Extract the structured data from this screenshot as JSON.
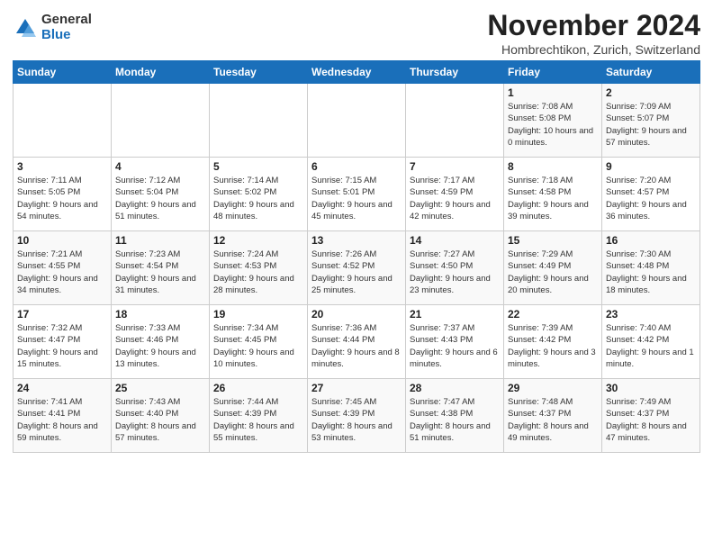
{
  "logo": {
    "general": "General",
    "blue": "Blue"
  },
  "title": "November 2024",
  "location": "Hombrechtikon, Zurich, Switzerland",
  "weekdays": [
    "Sunday",
    "Monday",
    "Tuesday",
    "Wednesday",
    "Thursday",
    "Friday",
    "Saturday"
  ],
  "weeks": [
    [
      {
        "day": "",
        "sunrise": "",
        "sunset": "",
        "daylight": ""
      },
      {
        "day": "",
        "sunrise": "",
        "sunset": "",
        "daylight": ""
      },
      {
        "day": "",
        "sunrise": "",
        "sunset": "",
        "daylight": ""
      },
      {
        "day": "",
        "sunrise": "",
        "sunset": "",
        "daylight": ""
      },
      {
        "day": "",
        "sunrise": "",
        "sunset": "",
        "daylight": ""
      },
      {
        "day": "1",
        "sunrise": "Sunrise: 7:08 AM",
        "sunset": "Sunset: 5:08 PM",
        "daylight": "Daylight: 10 hours and 0 minutes."
      },
      {
        "day": "2",
        "sunrise": "Sunrise: 7:09 AM",
        "sunset": "Sunset: 5:07 PM",
        "daylight": "Daylight: 9 hours and 57 minutes."
      }
    ],
    [
      {
        "day": "3",
        "sunrise": "Sunrise: 7:11 AM",
        "sunset": "Sunset: 5:05 PM",
        "daylight": "Daylight: 9 hours and 54 minutes."
      },
      {
        "day": "4",
        "sunrise": "Sunrise: 7:12 AM",
        "sunset": "Sunset: 5:04 PM",
        "daylight": "Daylight: 9 hours and 51 minutes."
      },
      {
        "day": "5",
        "sunrise": "Sunrise: 7:14 AM",
        "sunset": "Sunset: 5:02 PM",
        "daylight": "Daylight: 9 hours and 48 minutes."
      },
      {
        "day": "6",
        "sunrise": "Sunrise: 7:15 AM",
        "sunset": "Sunset: 5:01 PM",
        "daylight": "Daylight: 9 hours and 45 minutes."
      },
      {
        "day": "7",
        "sunrise": "Sunrise: 7:17 AM",
        "sunset": "Sunset: 4:59 PM",
        "daylight": "Daylight: 9 hours and 42 minutes."
      },
      {
        "day": "8",
        "sunrise": "Sunrise: 7:18 AM",
        "sunset": "Sunset: 4:58 PM",
        "daylight": "Daylight: 9 hours and 39 minutes."
      },
      {
        "day": "9",
        "sunrise": "Sunrise: 7:20 AM",
        "sunset": "Sunset: 4:57 PM",
        "daylight": "Daylight: 9 hours and 36 minutes."
      }
    ],
    [
      {
        "day": "10",
        "sunrise": "Sunrise: 7:21 AM",
        "sunset": "Sunset: 4:55 PM",
        "daylight": "Daylight: 9 hours and 34 minutes."
      },
      {
        "day": "11",
        "sunrise": "Sunrise: 7:23 AM",
        "sunset": "Sunset: 4:54 PM",
        "daylight": "Daylight: 9 hours and 31 minutes."
      },
      {
        "day": "12",
        "sunrise": "Sunrise: 7:24 AM",
        "sunset": "Sunset: 4:53 PM",
        "daylight": "Daylight: 9 hours and 28 minutes."
      },
      {
        "day": "13",
        "sunrise": "Sunrise: 7:26 AM",
        "sunset": "Sunset: 4:52 PM",
        "daylight": "Daylight: 9 hours and 25 minutes."
      },
      {
        "day": "14",
        "sunrise": "Sunrise: 7:27 AM",
        "sunset": "Sunset: 4:50 PM",
        "daylight": "Daylight: 9 hours and 23 minutes."
      },
      {
        "day": "15",
        "sunrise": "Sunrise: 7:29 AM",
        "sunset": "Sunset: 4:49 PM",
        "daylight": "Daylight: 9 hours and 20 minutes."
      },
      {
        "day": "16",
        "sunrise": "Sunrise: 7:30 AM",
        "sunset": "Sunset: 4:48 PM",
        "daylight": "Daylight: 9 hours and 18 minutes."
      }
    ],
    [
      {
        "day": "17",
        "sunrise": "Sunrise: 7:32 AM",
        "sunset": "Sunset: 4:47 PM",
        "daylight": "Daylight: 9 hours and 15 minutes."
      },
      {
        "day": "18",
        "sunrise": "Sunrise: 7:33 AM",
        "sunset": "Sunset: 4:46 PM",
        "daylight": "Daylight: 9 hours and 13 minutes."
      },
      {
        "day": "19",
        "sunrise": "Sunrise: 7:34 AM",
        "sunset": "Sunset: 4:45 PM",
        "daylight": "Daylight: 9 hours and 10 minutes."
      },
      {
        "day": "20",
        "sunrise": "Sunrise: 7:36 AM",
        "sunset": "Sunset: 4:44 PM",
        "daylight": "Daylight: 9 hours and 8 minutes."
      },
      {
        "day": "21",
        "sunrise": "Sunrise: 7:37 AM",
        "sunset": "Sunset: 4:43 PM",
        "daylight": "Daylight: 9 hours and 6 minutes."
      },
      {
        "day": "22",
        "sunrise": "Sunrise: 7:39 AM",
        "sunset": "Sunset: 4:42 PM",
        "daylight": "Daylight: 9 hours and 3 minutes."
      },
      {
        "day": "23",
        "sunrise": "Sunrise: 7:40 AM",
        "sunset": "Sunset: 4:42 PM",
        "daylight": "Daylight: 9 hours and 1 minute."
      }
    ],
    [
      {
        "day": "24",
        "sunrise": "Sunrise: 7:41 AM",
        "sunset": "Sunset: 4:41 PM",
        "daylight": "Daylight: 8 hours and 59 minutes."
      },
      {
        "day": "25",
        "sunrise": "Sunrise: 7:43 AM",
        "sunset": "Sunset: 4:40 PM",
        "daylight": "Daylight: 8 hours and 57 minutes."
      },
      {
        "day": "26",
        "sunrise": "Sunrise: 7:44 AM",
        "sunset": "Sunset: 4:39 PM",
        "daylight": "Daylight: 8 hours and 55 minutes."
      },
      {
        "day": "27",
        "sunrise": "Sunrise: 7:45 AM",
        "sunset": "Sunset: 4:39 PM",
        "daylight": "Daylight: 8 hours and 53 minutes."
      },
      {
        "day": "28",
        "sunrise": "Sunrise: 7:47 AM",
        "sunset": "Sunset: 4:38 PM",
        "daylight": "Daylight: 8 hours and 51 minutes."
      },
      {
        "day": "29",
        "sunrise": "Sunrise: 7:48 AM",
        "sunset": "Sunset: 4:37 PM",
        "daylight": "Daylight: 8 hours and 49 minutes."
      },
      {
        "day": "30",
        "sunrise": "Sunrise: 7:49 AM",
        "sunset": "Sunset: 4:37 PM",
        "daylight": "Daylight: 8 hours and 47 minutes."
      }
    ]
  ]
}
